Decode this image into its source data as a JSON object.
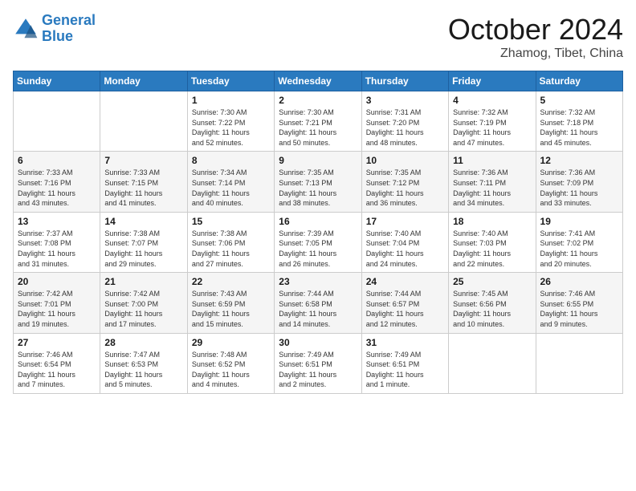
{
  "header": {
    "logo_line1": "General",
    "logo_line2": "Blue",
    "month": "October 2024",
    "location": "Zhamog, Tibet, China"
  },
  "weekdays": [
    "Sunday",
    "Monday",
    "Tuesday",
    "Wednesday",
    "Thursday",
    "Friday",
    "Saturday"
  ],
  "weeks": [
    [
      {
        "day": "",
        "info": ""
      },
      {
        "day": "",
        "info": ""
      },
      {
        "day": "1",
        "info": "Sunrise: 7:30 AM\nSunset: 7:22 PM\nDaylight: 11 hours\nand 52 minutes."
      },
      {
        "day": "2",
        "info": "Sunrise: 7:30 AM\nSunset: 7:21 PM\nDaylight: 11 hours\nand 50 minutes."
      },
      {
        "day": "3",
        "info": "Sunrise: 7:31 AM\nSunset: 7:20 PM\nDaylight: 11 hours\nand 48 minutes."
      },
      {
        "day": "4",
        "info": "Sunrise: 7:32 AM\nSunset: 7:19 PM\nDaylight: 11 hours\nand 47 minutes."
      },
      {
        "day": "5",
        "info": "Sunrise: 7:32 AM\nSunset: 7:18 PM\nDaylight: 11 hours\nand 45 minutes."
      }
    ],
    [
      {
        "day": "6",
        "info": "Sunrise: 7:33 AM\nSunset: 7:16 PM\nDaylight: 11 hours\nand 43 minutes."
      },
      {
        "day": "7",
        "info": "Sunrise: 7:33 AM\nSunset: 7:15 PM\nDaylight: 11 hours\nand 41 minutes."
      },
      {
        "day": "8",
        "info": "Sunrise: 7:34 AM\nSunset: 7:14 PM\nDaylight: 11 hours\nand 40 minutes."
      },
      {
        "day": "9",
        "info": "Sunrise: 7:35 AM\nSunset: 7:13 PM\nDaylight: 11 hours\nand 38 minutes."
      },
      {
        "day": "10",
        "info": "Sunrise: 7:35 AM\nSunset: 7:12 PM\nDaylight: 11 hours\nand 36 minutes."
      },
      {
        "day": "11",
        "info": "Sunrise: 7:36 AM\nSunset: 7:11 PM\nDaylight: 11 hours\nand 34 minutes."
      },
      {
        "day": "12",
        "info": "Sunrise: 7:36 AM\nSunset: 7:09 PM\nDaylight: 11 hours\nand 33 minutes."
      }
    ],
    [
      {
        "day": "13",
        "info": "Sunrise: 7:37 AM\nSunset: 7:08 PM\nDaylight: 11 hours\nand 31 minutes."
      },
      {
        "day": "14",
        "info": "Sunrise: 7:38 AM\nSunset: 7:07 PM\nDaylight: 11 hours\nand 29 minutes."
      },
      {
        "day": "15",
        "info": "Sunrise: 7:38 AM\nSunset: 7:06 PM\nDaylight: 11 hours\nand 27 minutes."
      },
      {
        "day": "16",
        "info": "Sunrise: 7:39 AM\nSunset: 7:05 PM\nDaylight: 11 hours\nand 26 minutes."
      },
      {
        "day": "17",
        "info": "Sunrise: 7:40 AM\nSunset: 7:04 PM\nDaylight: 11 hours\nand 24 minutes."
      },
      {
        "day": "18",
        "info": "Sunrise: 7:40 AM\nSunset: 7:03 PM\nDaylight: 11 hours\nand 22 minutes."
      },
      {
        "day": "19",
        "info": "Sunrise: 7:41 AM\nSunset: 7:02 PM\nDaylight: 11 hours\nand 20 minutes."
      }
    ],
    [
      {
        "day": "20",
        "info": "Sunrise: 7:42 AM\nSunset: 7:01 PM\nDaylight: 11 hours\nand 19 minutes."
      },
      {
        "day": "21",
        "info": "Sunrise: 7:42 AM\nSunset: 7:00 PM\nDaylight: 11 hours\nand 17 minutes."
      },
      {
        "day": "22",
        "info": "Sunrise: 7:43 AM\nSunset: 6:59 PM\nDaylight: 11 hours\nand 15 minutes."
      },
      {
        "day": "23",
        "info": "Sunrise: 7:44 AM\nSunset: 6:58 PM\nDaylight: 11 hours\nand 14 minutes."
      },
      {
        "day": "24",
        "info": "Sunrise: 7:44 AM\nSunset: 6:57 PM\nDaylight: 11 hours\nand 12 minutes."
      },
      {
        "day": "25",
        "info": "Sunrise: 7:45 AM\nSunset: 6:56 PM\nDaylight: 11 hours\nand 10 minutes."
      },
      {
        "day": "26",
        "info": "Sunrise: 7:46 AM\nSunset: 6:55 PM\nDaylight: 11 hours\nand 9 minutes."
      }
    ],
    [
      {
        "day": "27",
        "info": "Sunrise: 7:46 AM\nSunset: 6:54 PM\nDaylight: 11 hours\nand 7 minutes."
      },
      {
        "day": "28",
        "info": "Sunrise: 7:47 AM\nSunset: 6:53 PM\nDaylight: 11 hours\nand 5 minutes."
      },
      {
        "day": "29",
        "info": "Sunrise: 7:48 AM\nSunset: 6:52 PM\nDaylight: 11 hours\nand 4 minutes."
      },
      {
        "day": "30",
        "info": "Sunrise: 7:49 AM\nSunset: 6:51 PM\nDaylight: 11 hours\nand 2 minutes."
      },
      {
        "day": "31",
        "info": "Sunrise: 7:49 AM\nSunset: 6:51 PM\nDaylight: 11 hours\nand 1 minute."
      },
      {
        "day": "",
        "info": ""
      },
      {
        "day": "",
        "info": ""
      }
    ]
  ]
}
